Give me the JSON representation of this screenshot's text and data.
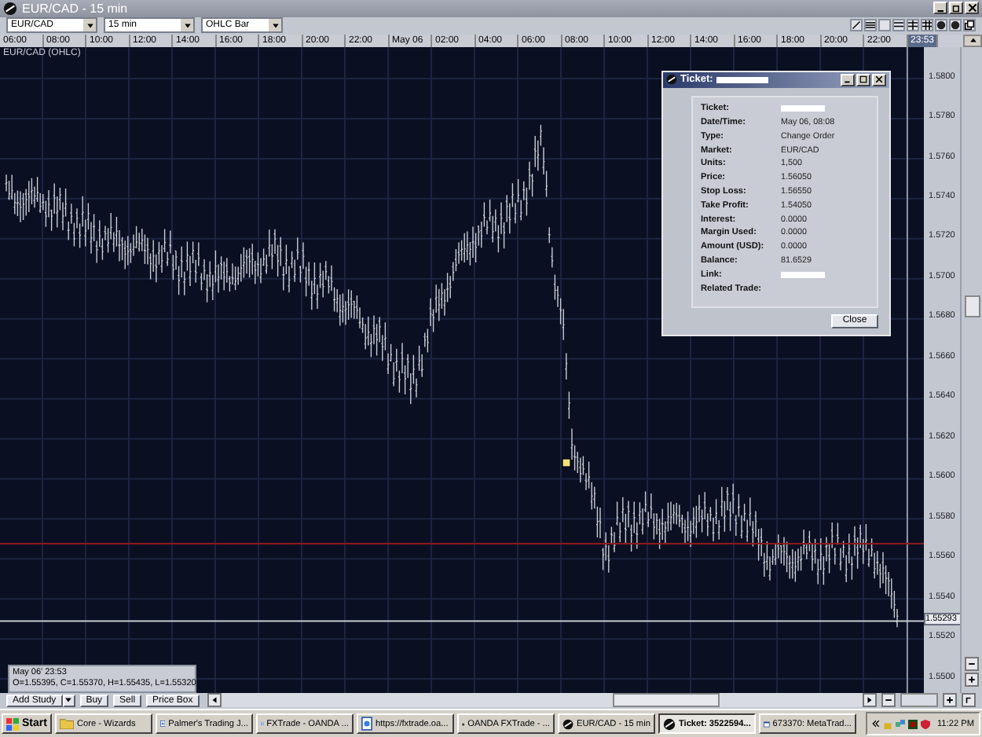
{
  "window": {
    "title": "EUR/CAD - 15 min"
  },
  "toolbar": {
    "instrument": "EUR/CAD",
    "interval": "15 min",
    "chart_type": "OHLC Bar"
  },
  "time_axis": {
    "labels": [
      "06:00",
      "08:00",
      "10:00",
      "12:00",
      "14:00",
      "16:00",
      "18:00",
      "20:00",
      "22:00",
      "May 06",
      "02:00",
      "04:00",
      "06:00",
      "08:00",
      "10:00",
      "12:00",
      "14:00",
      "16:00",
      "18:00",
      "20:00",
      "22:00"
    ],
    "cursor_time": "23:53"
  },
  "chart": {
    "legend": "EUR/CAD (OHLC)",
    "current_price": "1.55293"
  },
  "price_axis": {
    "labels": [
      "1.5800",
      "1.5780",
      "1.5760",
      "1.5740",
      "1.5720",
      "1.5700",
      "1.5680",
      "1.5660",
      "1.5640",
      "1.5620",
      "1.5600",
      "1.5580",
      "1.5560",
      "1.5540",
      "1.5520",
      "1.5500"
    ]
  },
  "info_box": {
    "date": "May 06' 23:53",
    "ohlc": "O=1.55395, C=1.55370, H=1.55435, L=1.55320"
  },
  "ticket_dialog": {
    "title": "Ticket:",
    "fields": [
      {
        "label": "Ticket:",
        "kind": "blank"
      },
      {
        "label": "Date/Time:",
        "kind": "text",
        "value": "May 06, 08:08"
      },
      {
        "label": "Type:",
        "kind": "text",
        "value": "Change Order"
      },
      {
        "label": "Market:",
        "kind": "text",
        "value": "EUR/CAD"
      },
      {
        "label": "Units:",
        "kind": "text",
        "value": "1,500"
      },
      {
        "label": "Price:",
        "kind": "text",
        "value": "1.56050"
      },
      {
        "label": "Stop Loss:",
        "kind": "text",
        "value": "1.56550"
      },
      {
        "label": "Take Profit:",
        "kind": "text",
        "value": "1.54050"
      },
      {
        "label": "Interest:",
        "kind": "text",
        "value": "0.0000"
      },
      {
        "label": "Margin Used:",
        "kind": "text",
        "value": "0.0000"
      },
      {
        "label": "Amount (USD):",
        "kind": "text",
        "value": "0.0000"
      },
      {
        "label": "Balance:",
        "kind": "text",
        "value": "81.6529"
      },
      {
        "label": "Link:",
        "kind": "blank"
      },
      {
        "label": "Related Trade:",
        "kind": "none"
      }
    ],
    "close_button": "Close"
  },
  "bottom_toolbar": {
    "buttons": [
      "Add Study",
      "Buy",
      "Sell",
      "Price Box"
    ]
  },
  "taskbar": {
    "start": "Start",
    "items": [
      {
        "label": "Core - Wizards",
        "kind": "folder",
        "selected": false
      },
      {
        "label": "Palmer's Trading J...",
        "kind": "page",
        "selected": false
      },
      {
        "label": "FXTrade - OANDA ...",
        "kind": "page",
        "selected": false
      },
      {
        "label": "https://fxtrade.oa...",
        "kind": "page",
        "selected": false
      },
      {
        "label": "OANDA FXTrade - ...",
        "kind": "disc",
        "selected": false
      },
      {
        "label": "EUR/CAD - 15 min",
        "kind": "disc",
        "selected": false
      },
      {
        "label": "Ticket: 3522594...",
        "kind": "disc",
        "selected": true
      },
      {
        "label": "673370: MetaTrad...",
        "kind": "window",
        "selected": false
      }
    ],
    "clock": "11:22 PM"
  }
}
